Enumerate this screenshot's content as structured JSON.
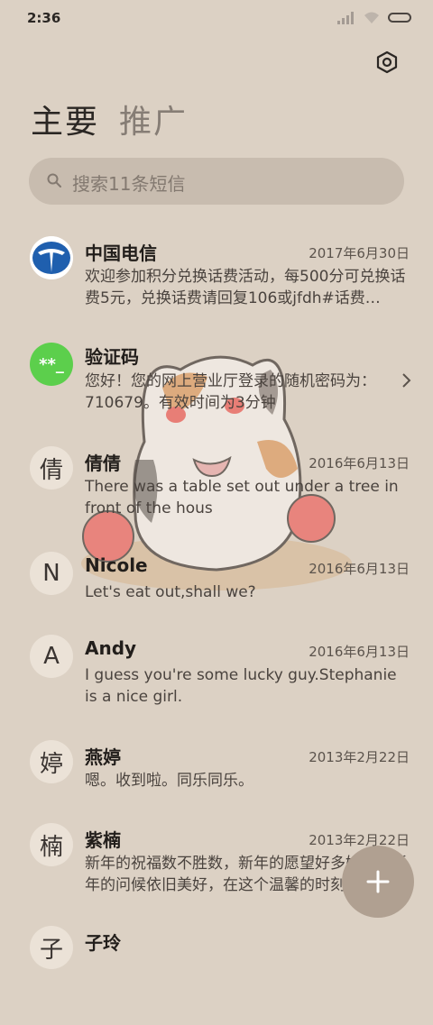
{
  "status": {
    "time": "2:36"
  },
  "tabs": {
    "primary": "主要",
    "promo": "推广"
  },
  "search": {
    "placeholder": "搜索11条短信"
  },
  "messages": [
    {
      "avatar": "",
      "sender": "中国电信",
      "date": "2017年6月30日",
      "preview": "欢迎参加积分兑换话费活动，每500分可兑换话费5元，兑换话费请回复106或jfdh#话费…"
    },
    {
      "avatar": "**_",
      "sender": "验证码",
      "date": "",
      "preview": "您好！您的网上营业厅登录的随机密码为：710679。有效时间为3分钟"
    },
    {
      "avatar": "倩",
      "sender": "倩倩",
      "date": "2016年6月13日",
      "preview": "There was a table set out under a tree in front of the hous"
    },
    {
      "avatar": "N",
      "sender": "Nicole",
      "date": "2016年6月13日",
      "preview": "Let's eat out,shall we?"
    },
    {
      "avatar": "A",
      "sender": "Andy",
      "date": "2016年6月13日",
      "preview": "I guess you're some lucky guy.Stephanie is a nice girl."
    },
    {
      "avatar": "婷",
      "sender": "燕婷",
      "date": "2013年2月22日",
      "preview": "嗯。收到啦。同乐同乐。"
    },
    {
      "avatar": "楠",
      "sender": "紫楠",
      "date": "2013年2月22日",
      "preview": "新年的祝福数不胜数，新年的愿望好多好多，新年的问候依旧美好，在这个温馨的时刻"
    },
    {
      "avatar": "子",
      "sender": "子玲",
      "date": "",
      "preview": ""
    }
  ],
  "colors": {
    "background": "#dcd1c4",
    "verify_avatar": "#5ccf4c",
    "telecom_blue": "#1f5fae",
    "fab": "#b0a091"
  },
  "icons": {
    "settings": "settings-icon",
    "search": "search-icon",
    "compose": "plus-icon",
    "chevron": "chevron-right-icon"
  }
}
